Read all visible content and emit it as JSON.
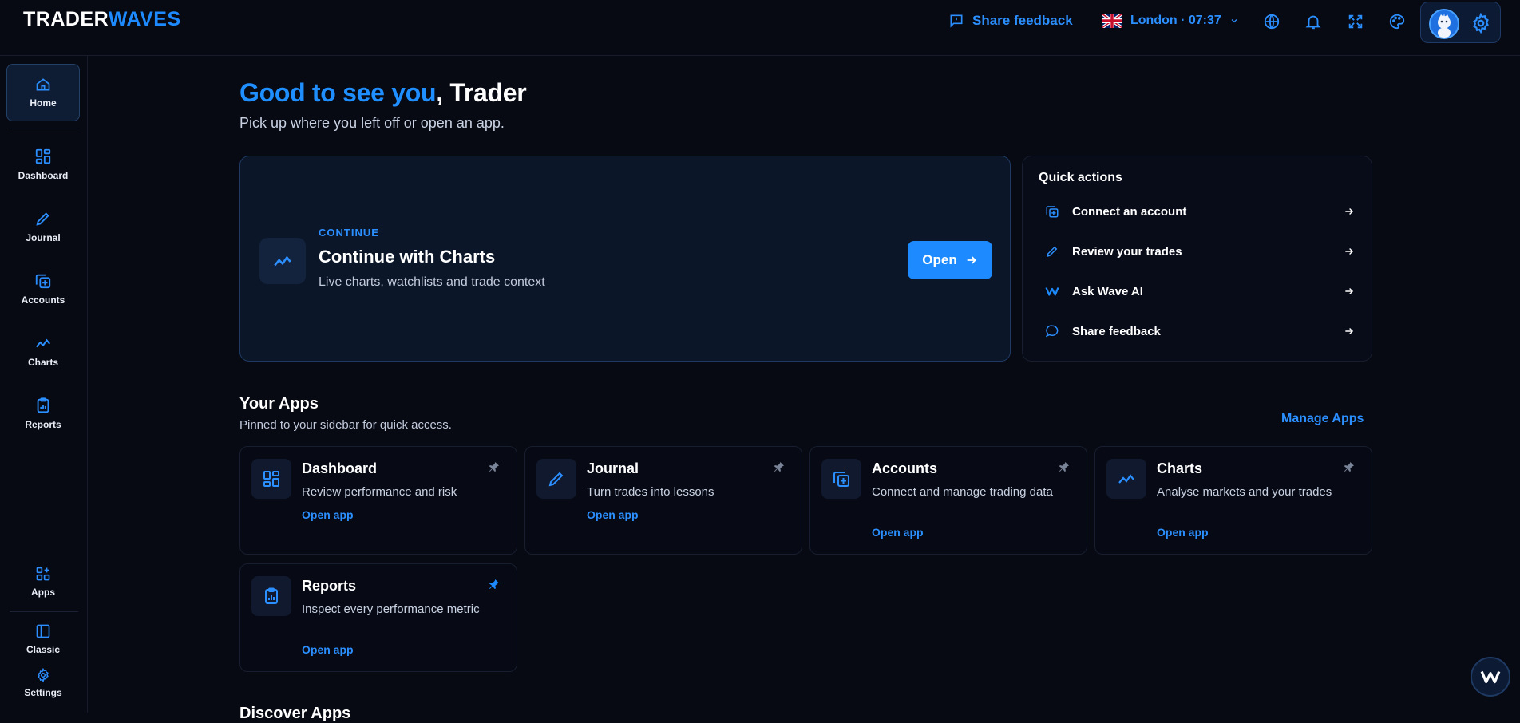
{
  "header": {
    "logo_part1": "TRADER",
    "logo_part2": "WAVES",
    "feedback_label": "Share feedback",
    "location": "London · 07:37",
    "icons": [
      "feedback-icon",
      "flag-uk-icon",
      "chevron-down-icon",
      "globe-icon",
      "bell-icon",
      "fullscreen-icon",
      "palette-icon",
      "avatar",
      "gear-icon"
    ]
  },
  "sidebar": {
    "items": [
      {
        "label": "Home",
        "icon": "home-icon",
        "active": true
      },
      {
        "label": "Dashboard",
        "icon": "grid-icon"
      },
      {
        "label": "Journal",
        "icon": "pencil-icon"
      },
      {
        "label": "Accounts",
        "icon": "add-account-icon"
      },
      {
        "label": "Charts",
        "icon": "chart-line-icon"
      },
      {
        "label": "Reports",
        "icon": "clipboard-icon"
      }
    ],
    "bottom": [
      {
        "label": "Apps",
        "icon": "apps-add-icon"
      },
      {
        "label": "Classic",
        "icon": "sidebar-layout-icon"
      },
      {
        "label": "Settings",
        "icon": "gear-icon"
      }
    ]
  },
  "main": {
    "greeting_highlight": "Good to see you",
    "greeting_name": ", Trader",
    "subtitle": "Pick up where you left off or open an app.",
    "continue_card": {
      "kicker": "CONTINUE",
      "title": "Continue with Charts",
      "description": "Live charts, watchlists and trade context",
      "button": "Open"
    },
    "quick_actions": {
      "title": "Quick actions",
      "items": [
        {
          "label": "Connect an account",
          "icon": "add-account-icon"
        },
        {
          "label": "Review your trades",
          "icon": "pencil-icon"
        },
        {
          "label": "Ask Wave AI",
          "icon": "wave-logo-icon"
        },
        {
          "label": "Share feedback",
          "icon": "chat-bubble-icon"
        }
      ]
    },
    "your_apps": {
      "title": "Your Apps",
      "subtitle": "Pinned to your sidebar for quick access.",
      "manage": "Manage Apps",
      "apps": [
        {
          "name": "Dashboard",
          "description": "Review performance and risk",
          "link": "Open app",
          "pinned_active": false
        },
        {
          "name": "Journal",
          "description": "Turn trades into lessons",
          "link": "Open app",
          "pinned_active": false
        },
        {
          "name": "Accounts",
          "description": "Connect and manage trading data",
          "link": "Open app",
          "pinned_active": false
        },
        {
          "name": "Charts",
          "description": "Analyse markets and your trades",
          "link": "Open app",
          "pinned_active": false
        },
        {
          "name": "Reports",
          "description": "Inspect every performance metric",
          "link": "Open app",
          "pinned_active": true
        }
      ]
    },
    "discover_title": "Discover Apps"
  },
  "colors": {
    "accent": "#1d8bff",
    "background": "#070913",
    "card": "#0b1628"
  }
}
